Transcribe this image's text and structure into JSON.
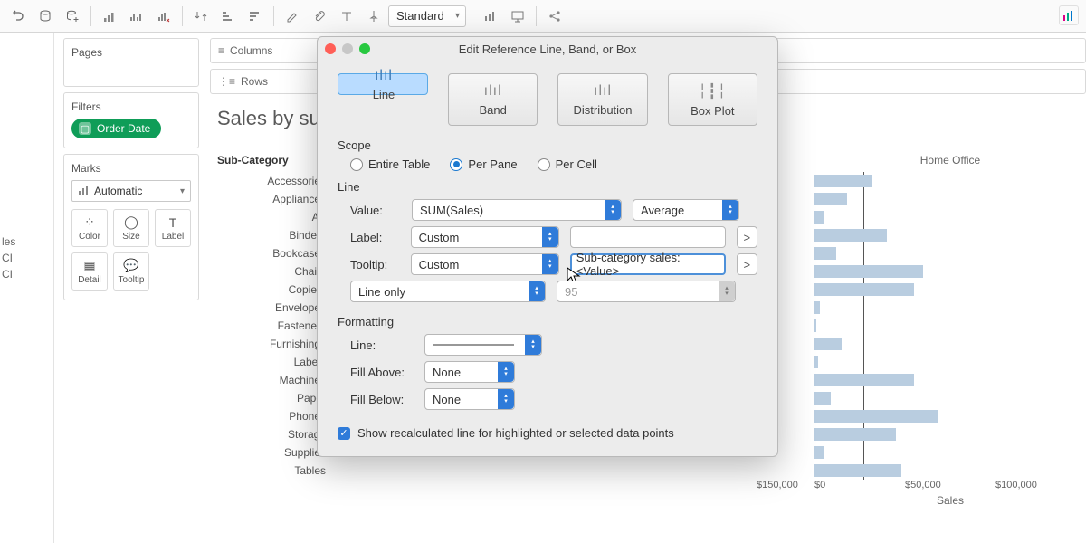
{
  "toolbar": {
    "fit_select": "Standard"
  },
  "left": {
    "pages_title": "Pages",
    "filters_title": "Filters",
    "filter_pill": "Order Date",
    "marks_title": "Marks",
    "marks_type": "Automatic",
    "marks_cells": [
      "Color",
      "Size",
      "Label",
      "Detail",
      "Tooltip"
    ]
  },
  "shelves": {
    "columns": "Columns",
    "rows": "Rows"
  },
  "viz": {
    "title": "Sales by su",
    "row_header": "Sub-Category",
    "rows": [
      "Accessories",
      "Appliances",
      "Art",
      "Binders",
      "Bookcases",
      "Chairs",
      "Copiers",
      "Envelopes",
      "Fasteners",
      "Furnishings",
      "Labels",
      "Machines",
      "Paper",
      "Phones",
      "Storage",
      "Supplies",
      "Tables"
    ],
    "right_col_header": "Home Office",
    "xaxis_prev": "$150,000",
    "xaxis_ticks": [
      "$0",
      "$50,000",
      "$100,000"
    ],
    "xaxis_label": "Sales"
  },
  "cut_left": {
    "l1": "les",
    "l2": "CI",
    "l3": "CI"
  },
  "dialog": {
    "title": "Edit Reference Line, Band, or Box",
    "tabs": [
      "Line",
      "Band",
      "Distribution",
      "Box Plot"
    ],
    "scope_label": "Scope",
    "scope_options": [
      "Entire Table",
      "Per Pane",
      "Per Cell"
    ],
    "line_section": "Line",
    "value_label": "Value:",
    "value_field": "SUM(Sales)",
    "value_agg": "Average",
    "label_label": "Label:",
    "label_mode": "Custom",
    "label_text": "",
    "tooltip_label": "Tooltip:",
    "tooltip_mode": "Custom",
    "tooltip_text": "Sub-category sales:<Value>",
    "line_only": "Line only",
    "confidence": "95",
    "formatting_label": "Formatting",
    "fmt_line": "Line:",
    "fill_above": "Fill Above:",
    "fill_above_val": "None",
    "fill_below": "Fill Below:",
    "fill_below_val": "None",
    "recalc": "Show recalculated line for highlighted or selected data points",
    "caret": ">"
  },
  "chart_data": {
    "type": "bar",
    "title": "Sales by Sub-Category — Home Office segment",
    "xlabel": "Sales",
    "ylabel": "Sub-Category",
    "xlim": [
      0,
      120000
    ],
    "reference_line": 27000,
    "categories": [
      "Accessories",
      "Appliances",
      "Art",
      "Binders",
      "Bookcases",
      "Chairs",
      "Copiers",
      "Envelopes",
      "Fasteners",
      "Furnishings",
      "Labels",
      "Machines",
      "Paper",
      "Phones",
      "Storage",
      "Supplies",
      "Tables"
    ],
    "values": [
      32000,
      18000,
      5000,
      40000,
      12000,
      60000,
      55000,
      3000,
      1000,
      15000,
      2000,
      55000,
      9000,
      68000,
      45000,
      5000,
      48000
    ]
  }
}
